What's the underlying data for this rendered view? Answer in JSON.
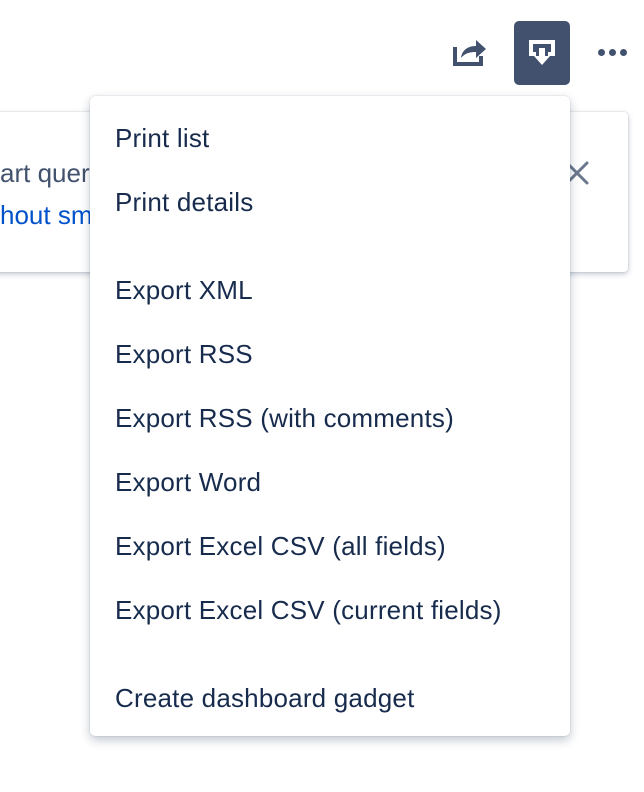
{
  "toolbar": {
    "share_icon": "share-icon",
    "export_icon": "export-download-icon",
    "more_icon": "more-dots-icon",
    "export_active_color": "#42526e"
  },
  "notice": {
    "line1_fragment": "art quer",
    "line2_fragment": "hout sm",
    "close_icon": "close-icon"
  },
  "dropdown": {
    "items": [
      {
        "label": "Print list"
      },
      {
        "label": "Print details"
      },
      {
        "label": "Export XML"
      },
      {
        "label": "Export RSS"
      },
      {
        "label": "Export RSS (with comments)"
      },
      {
        "label": "Export Word"
      },
      {
        "label": "Export Excel CSV (all fields)"
      },
      {
        "label": "Export Excel CSV (current fields)"
      },
      {
        "label": "Create dashboard gadget"
      }
    ]
  },
  "colors": {
    "text": "#172b4d",
    "link": "#0052cc",
    "icon": "#42526e"
  }
}
